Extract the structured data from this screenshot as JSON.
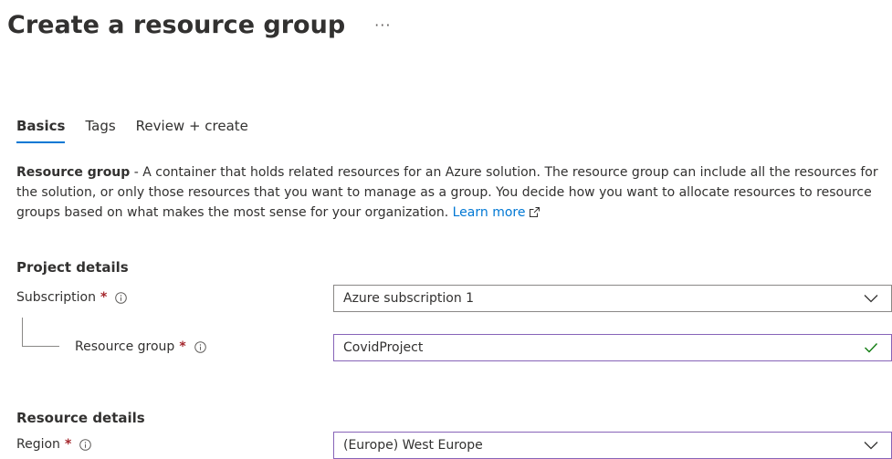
{
  "header": {
    "title": "Create a resource group",
    "more_label": "···"
  },
  "tabs": [
    {
      "label": "Basics",
      "selected": true
    },
    {
      "label": "Tags",
      "selected": false
    },
    {
      "label": "Review + create",
      "selected": false
    }
  ],
  "description": {
    "bold_label": "Resource group",
    "text": " - A container that holds related resources for an Azure solution. The resource group can include all the resources for the solution, or only those resources that you want to manage as a group. You decide how you want to allocate resources to resource groups based on what makes the most sense for your organization. ",
    "learn_more": "Learn more"
  },
  "project_details": {
    "heading": "Project details",
    "subscription": {
      "label": "Subscription",
      "required_mark": "*",
      "value": "Azure subscription 1"
    },
    "resource_group": {
      "label": "Resource group",
      "required_mark": "*",
      "value": "CovidProject"
    }
  },
  "resource_details": {
    "heading": "Resource details",
    "region": {
      "label": "Region",
      "required_mark": "*",
      "value": "(Europe) West Europe"
    }
  },
  "colors": {
    "accent": "#0078d4",
    "required": "#a4262c",
    "valid": "#107c10",
    "focus_border": "#8764b8"
  },
  "icons": {
    "info": "info-circle-icon",
    "external_link": "external-link-icon",
    "dropdown": "chevron-down-icon",
    "valid": "checkmark-icon"
  }
}
